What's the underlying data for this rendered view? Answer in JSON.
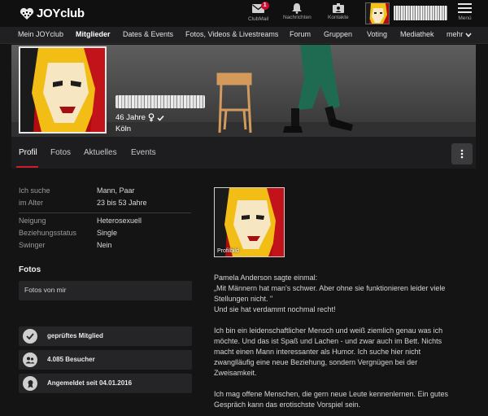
{
  "topbar": {
    "logo": "JOYclub",
    "items": [
      {
        "label": "ClubMail",
        "badge": "1"
      },
      {
        "label": "Nachrichten"
      },
      {
        "label": "Kontakte"
      }
    ],
    "menu_label": "Menü"
  },
  "nav": [
    "Mein JOYclub",
    "Mitglieder",
    "Dates & Events",
    "Fotos, Videos & Livestreams",
    "Forum",
    "Gruppen",
    "Voting",
    "Mediathek",
    "mehr"
  ],
  "profile": {
    "age": "46 Jahre",
    "city": "Köln"
  },
  "tabs": [
    "Profil",
    "Fotos",
    "Aktuelles",
    "Events"
  ],
  "details": [
    {
      "label": "Ich suche",
      "value": "Mann,  Paar"
    },
    {
      "label": "im Alter",
      "value": "23 bis 53 Jahre"
    },
    {
      "label": "Neigung",
      "value": "Heterosexuell"
    },
    {
      "label": "Beziehungsstatus",
      "value": "Single"
    },
    {
      "label": "Swinger",
      "value": "Nein"
    }
  ],
  "fotos": {
    "title": "Fotos",
    "box": "Fotos von mir"
  },
  "stats": [
    {
      "text": "geprüftes Mitglied",
      "icon": "check-icon"
    },
    {
      "text": "4.085 Besucher",
      "icon": "users-icon"
    },
    {
      "text": "Angemeldet seit 04.01.2016",
      "icon": "ribbon-icon"
    }
  ],
  "thumb_label": "Profilbild",
  "bio": [
    "Pamela Anderson sagte einmal:",
    "„Mit Männern hat man's schwer. Aber ohne sie funktionieren leider viele",
    "Stellungen nicht. \"",
    "Und sie hat verdammt nochmal recht!",
    "Ich bin ein leidenschaftlicher Mensch und weiß ziemlich genau was ich",
    "möchte. Und das ist Spaß und Lachen - und zwar auch im Bett. Nichts",
    "macht einen Mann interessanter als Humor. Ich suche hier nicht",
    "zwanglläufig eine neue Beziehung, sondern Vergnügen bei der",
    "Zweisamkeit.",
    "Ich mag offene Menschen, die gern neue Leute kennenlernen. Ein gutes",
    "Gespräch kann das erotischste Vorspiel sein."
  ],
  "colors": {
    "accent": "#d11a2a",
    "background": "#141415"
  }
}
